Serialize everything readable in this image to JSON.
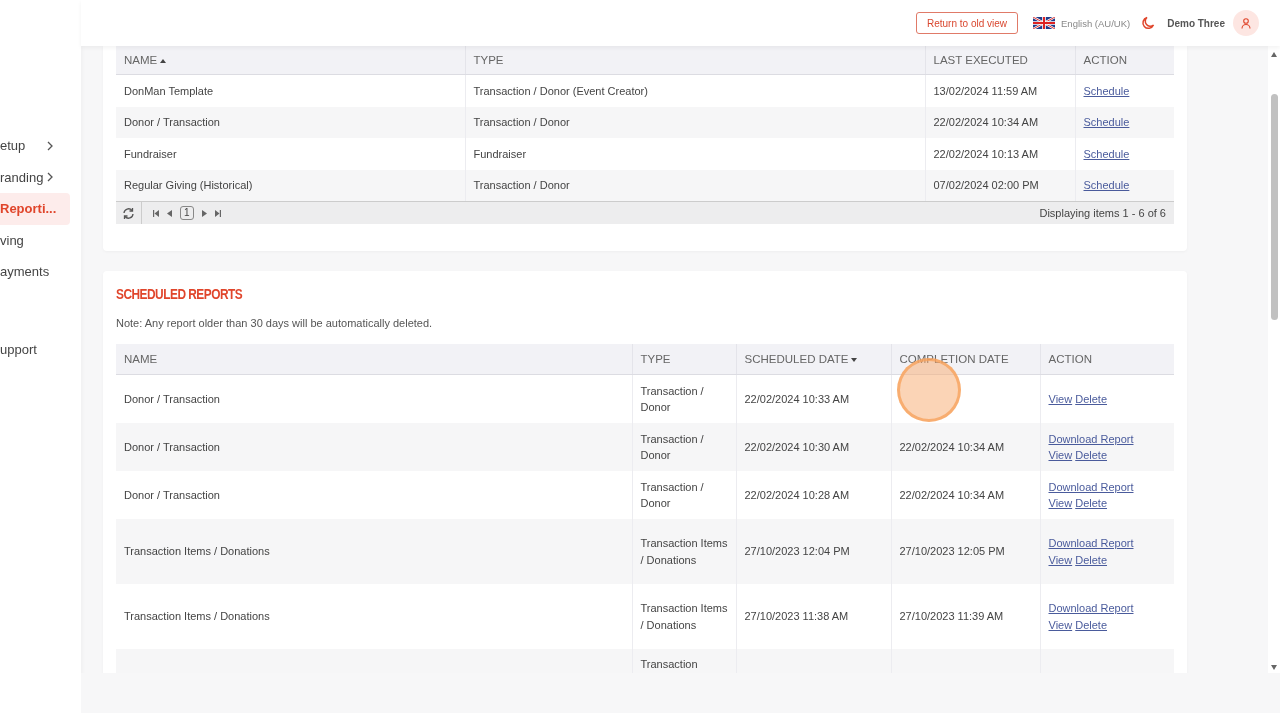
{
  "sidebar": {
    "items": [
      {
        "label": "etup",
        "expandable": true,
        "selected": false
      },
      {
        "label": "randing",
        "expandable": true,
        "selected": false
      },
      {
        "label": "Reporti...",
        "expandable": false,
        "selected": true
      },
      {
        "label": "ving",
        "expandable": false,
        "selected": false
      },
      {
        "label": "ayments",
        "expandable": false,
        "selected": false
      },
      {
        "label": "upport",
        "expandable": false,
        "selected": false
      }
    ]
  },
  "header": {
    "return_button": "Return to old view",
    "language": "English (AU/UK)",
    "user_name": "Demo Three"
  },
  "templates_table": {
    "columns": [
      {
        "label": "NAME",
        "sorted_ascending": true,
        "sorted_descending": false
      },
      {
        "label": "TYPE",
        "sorted_ascending": false,
        "sorted_descending": false
      },
      {
        "label": "LAST EXECUTED",
        "sorted_ascending": false,
        "sorted_descending": false
      },
      {
        "label": "ACTION",
        "sorted_ascending": false,
        "sorted_descending": false
      }
    ],
    "rows": [
      {
        "name": "DonMan Template",
        "type": "Transaction / Donor (Event Creator)",
        "last_executed": "13/02/2024 11:59 AM",
        "action": "Schedule"
      },
      {
        "name": "Donor / Transaction",
        "type": "Transaction / Donor",
        "last_executed": "22/02/2024 10:34 AM",
        "action": "Schedule"
      },
      {
        "name": "Fundraiser",
        "type": "Fundraiser",
        "last_executed": "22/02/2024 10:13 AM",
        "action": "Schedule"
      },
      {
        "name": "Regular Giving (Historical)",
        "type": "Transaction / Donor",
        "last_executed": "07/02/2024 02:00 PM",
        "action": "Schedule"
      }
    ],
    "pager": {
      "page": "1",
      "summary": "Displaying items 1 - 6 of 6"
    }
  },
  "scheduled_reports": {
    "title": "SCHEDULED REPORTS",
    "note": "Note: Any report older than 30 days will be automatically deleted.",
    "columns": [
      {
        "label": "NAME",
        "sorted_ascending": false,
        "sorted_descending": false
      },
      {
        "label": "TYPE",
        "sorted_ascending": false,
        "sorted_descending": false
      },
      {
        "label": "SCHEDULED DATE",
        "sorted_ascending": false,
        "sorted_descending": true
      },
      {
        "label": "COMPLETION DATE",
        "sorted_ascending": false,
        "sorted_descending": false
      },
      {
        "label": "ACTION",
        "sorted_ascending": false,
        "sorted_descending": false
      }
    ],
    "rows": [
      {
        "name": "Donor / Transaction",
        "type": "Transaction / Donor",
        "scheduled": "22/02/2024 10:33 AM",
        "actions": [
          "View",
          "Delete"
        ]
      },
      {
        "name": "Donor / Transaction",
        "type": "Transaction / Donor",
        "scheduled": "22/02/2024 10:30 AM",
        "completed": "22/02/2024 10:34 AM",
        "download": "Download Report",
        "actions": [
          "View",
          "Delete"
        ]
      },
      {
        "name": "Donor / Transaction",
        "type": "Transaction / Donor",
        "scheduled": "22/02/2024 10:28 AM",
        "completed": "22/02/2024 10:34 AM",
        "download": "Download Report",
        "actions": [
          "View",
          "Delete"
        ]
      },
      {
        "name": "Transaction Items / Donations",
        "type": "Transaction Items / Donations",
        "scheduled": "27/10/2023 12:04 PM",
        "completed": "27/10/2023 12:05 PM",
        "download": "Download Report",
        "actions": [
          "View",
          "Delete"
        ]
      },
      {
        "name": "Transaction Items / Donations",
        "type": "Transaction Items / Donations",
        "scheduled": "27/10/2023 11:38 AM",
        "completed": "27/10/2023 11:39 AM",
        "download": "Download Report",
        "actions": [
          "View",
          "Delete"
        ]
      },
      {
        "type": "Transaction"
      }
    ]
  }
}
